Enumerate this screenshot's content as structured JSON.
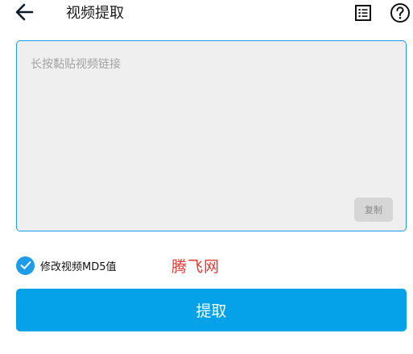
{
  "header": {
    "title": "视频提取",
    "back_icon": "arrow-left-icon",
    "list_icon": "list-icon",
    "help_icon": "help-circle-icon"
  },
  "link_input": {
    "placeholder": "长按黏贴视频链接",
    "value": ""
  },
  "copy_button": {
    "label": "复制"
  },
  "md5_option": {
    "label": "修改视频MD5值",
    "checked": true
  },
  "watermark": {
    "text": "腾飞网"
  },
  "extract_button": {
    "label": "提取"
  },
  "colors": {
    "accent": "#05a1e9",
    "input_border": "#1e9be9",
    "watermark": "#e53935"
  }
}
